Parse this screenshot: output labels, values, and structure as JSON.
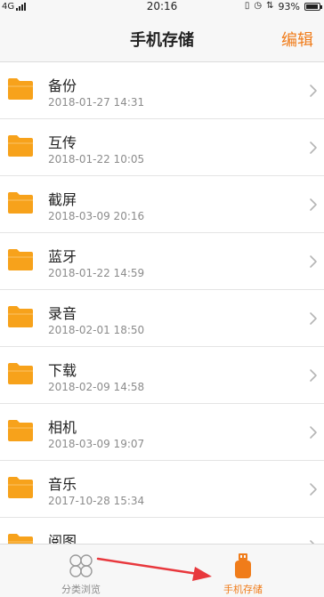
{
  "status_bar": {
    "network": "4G",
    "time": "20:16",
    "battery_percent": "93%",
    "battery_level": 0.93
  },
  "nav": {
    "title": "手机存储",
    "edit_label": "编辑"
  },
  "files": [
    {
      "name": "备份",
      "date": "2018-01-27 14:31"
    },
    {
      "name": "互传",
      "date": "2018-01-22 10:05"
    },
    {
      "name": "截屏",
      "date": "2018-03-09 20:16"
    },
    {
      "name": "蓝牙",
      "date": "2018-01-22 14:59"
    },
    {
      "name": "录音",
      "date": "2018-02-01 18:50"
    },
    {
      "name": "下载",
      "date": "2018-02-09 14:58"
    },
    {
      "name": "相机",
      "date": "2018-03-09 19:07"
    },
    {
      "name": "音乐",
      "date": "2017-10-28 15:34"
    },
    {
      "name": "阅图",
      "date": ""
    }
  ],
  "tabs": [
    {
      "label": "分类浏览",
      "icon": "category-grid-icon",
      "active": false
    },
    {
      "label": "手机存储",
      "icon": "phone-storage-icon",
      "active": true
    }
  ],
  "colors": {
    "accent": "#f07c1a",
    "folder": "#f7a21b",
    "annotation_arrow": "#e8383d"
  }
}
